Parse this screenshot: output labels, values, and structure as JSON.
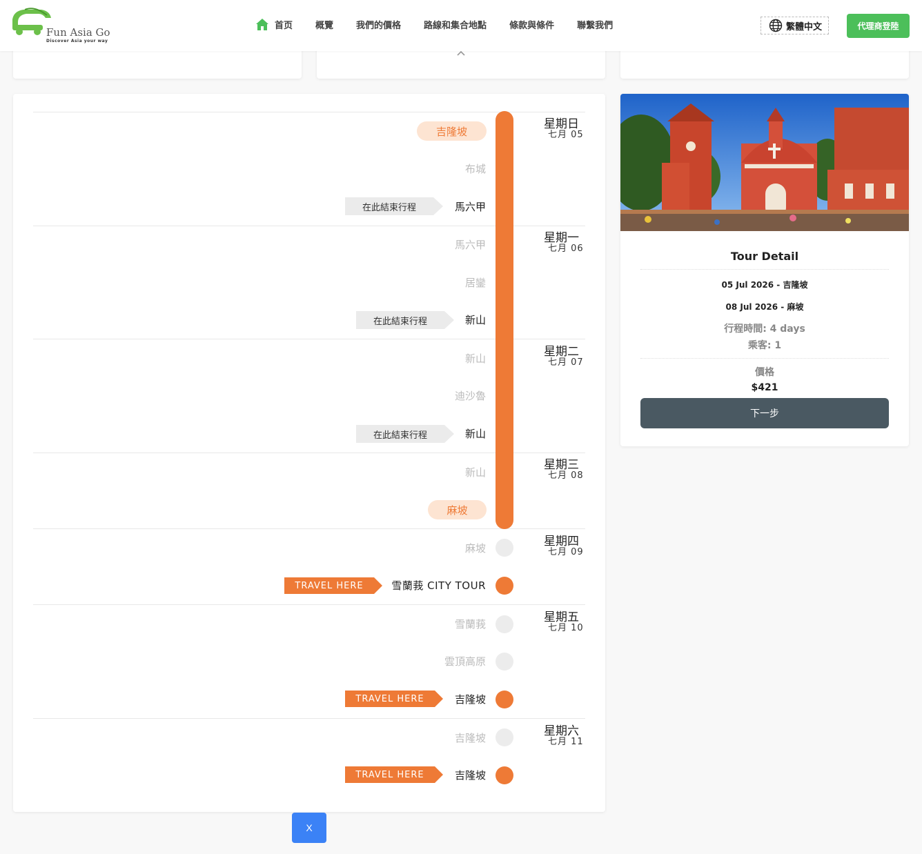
{
  "brand": {
    "name": "Fun Asia Go",
    "tagline": "Discover Asia your way"
  },
  "nav": {
    "items": [
      {
        "label": "首页",
        "icon": "home-icon"
      },
      {
        "label": "概覽"
      },
      {
        "label": "我們的價格"
      },
      {
        "label": "路線和集合地點"
      },
      {
        "label": "條款與條件"
      },
      {
        "label": "聯繫我們"
      }
    ],
    "language": "繁體中文",
    "agent_login": "代理商登陸"
  },
  "timeline": {
    "days": [
      {
        "day": "星期日",
        "date": "七月 05"
      },
      {
        "day": "星期一",
        "date": "七月 06"
      },
      {
        "day": "星期二",
        "date": "七月 07"
      },
      {
        "day": "星期三",
        "date": "七月 08"
      },
      {
        "day": "星期四",
        "date": "七月 09"
      },
      {
        "day": "星期五",
        "date": "七月 10"
      },
      {
        "day": "星期六",
        "date": "七月 11"
      }
    ],
    "stops": {
      "s1": "吉隆坡",
      "s2": "布城",
      "s3": "馬六甲",
      "s4": "馬六甲",
      "s5": "居鑾",
      "s6": "新山",
      "s7": "新山",
      "s8": "迪沙魯",
      "s9": "新山",
      "s10": "新山",
      "s11": "麻坡",
      "s12": "麻坡",
      "s13": "雪蘭莪 CITY TOUR",
      "s14": "雪蘭莪",
      "s15": "雲頂高原",
      "s16": "吉隆坡",
      "s17": "吉隆坡",
      "s18": "吉隆坡"
    },
    "end_here": "在此結束行程",
    "travel_here": "TRAVEL HERE"
  },
  "tour_detail": {
    "title": "Tour Detail",
    "start": "05 Jul 2026 - 吉隆坡",
    "end": "08 Jul 2026 - 麻坡",
    "duration": "行程時間: 4 days",
    "passengers": "乘客: 1",
    "price_label": "價格",
    "price": "$421",
    "next_button": "下一步"
  },
  "close_button": "X",
  "colors": {
    "accent": "#ee7a36",
    "brand_green": "#4cbf5a",
    "button_dark": "#4a5962",
    "close_blue": "#3b82f6"
  }
}
